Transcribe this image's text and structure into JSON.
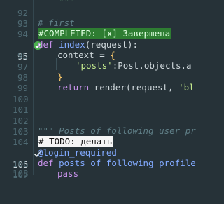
{
  "editor": {
    "lines": [
      {
        "num": "92",
        "text": "    \"\"\""
      },
      {
        "num": "93",
        "text": ""
      },
      {
        "num": "94",
        "text": "# first"
      },
      {
        "num": "95",
        "text": "#COMPLETED: [x] Завершена"
      },
      {
        "num": "96",
        "def": "def",
        "fn": "index",
        "rest": "(request):"
      },
      {
        "num": "97",
        "ctx": "context",
        "eq": " = ",
        "brace": "{"
      },
      {
        "num": "98",
        "key": "'posts'",
        "rest": ":Post.objects.a"
      },
      {
        "num": "99",
        "brace": "}"
      },
      {
        "num": "100",
        "kw": "return",
        "rest": " render(request, ",
        "str": "'bl"
      },
      {
        "num": "101",
        "text": ""
      },
      {
        "num": "102",
        "text": ""
      },
      {
        "num": "103",
        "text": ""
      },
      {
        "num": "104",
        "text": "\"\"\" Posts of following user pr"
      },
      {
        "num": "105",
        "text": "# TODO: делать"
      },
      {
        "num": "106",
        "text": "@login_required"
      },
      {
        "num": "107",
        "def": "def",
        "fn": "posts_of_following_profile"
      },
      {
        "num": "108",
        "kw": "pass"
      }
    ]
  },
  "colors": {
    "background": "#263238",
    "completed_highlight": "#2e7d32",
    "todo_highlight": "#f5f5f5"
  },
  "icons": {
    "completed_marker": "check-circle-icon",
    "todo_marker": "checkmark-icon"
  }
}
